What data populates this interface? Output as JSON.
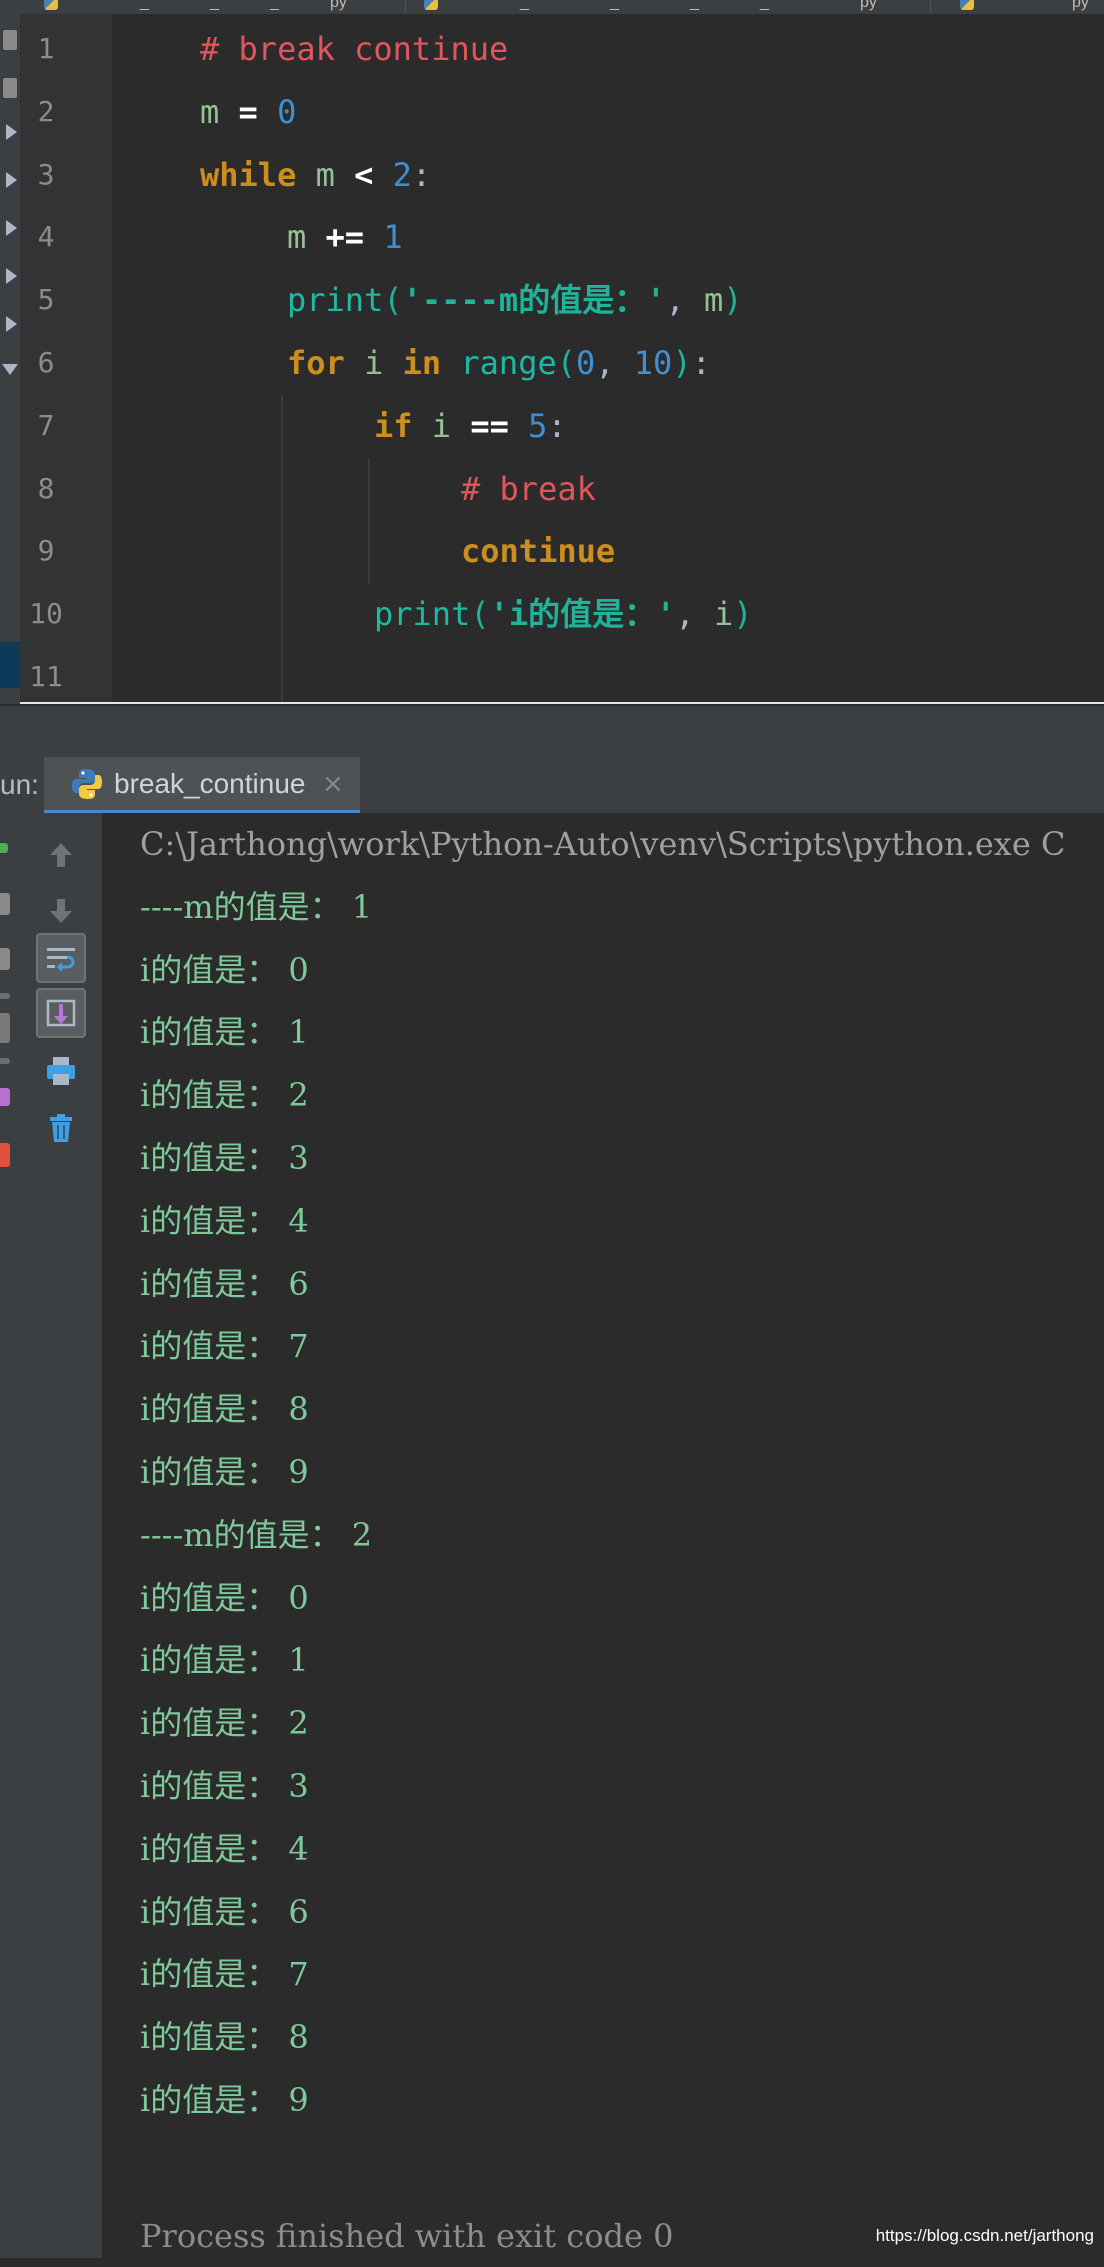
{
  "editor": {
    "tabs": [
      "_",
      "_",
      "_",
      "py",
      "_",
      "_",
      "_",
      "_",
      "py",
      "py"
    ],
    "lines": [
      {
        "num": "1",
        "indent": 0,
        "tokens": [
          {
            "t": "# break continue",
            "k": "comment"
          }
        ]
      },
      {
        "num": "2",
        "indent": 0,
        "tokens": [
          {
            "t": "m",
            "k": "var"
          },
          {
            "t": " ",
            "k": "punc"
          },
          {
            "t": "=",
            "k": "op"
          },
          {
            "t": " ",
            "k": "punc"
          },
          {
            "t": "0",
            "k": "num"
          }
        ]
      },
      {
        "num": "3",
        "indent": 0,
        "tokens": [
          {
            "t": "while",
            "k": "kw"
          },
          {
            "t": " ",
            "k": "punc"
          },
          {
            "t": "m",
            "k": "var"
          },
          {
            "t": " ",
            "k": "punc"
          },
          {
            "t": "<",
            "k": "op"
          },
          {
            "t": " ",
            "k": "punc"
          },
          {
            "t": "2",
            "k": "num"
          },
          {
            "t": ":",
            "k": "punc"
          }
        ]
      },
      {
        "num": "4",
        "indent": 1,
        "tokens": [
          {
            "t": "m",
            "k": "var"
          },
          {
            "t": " ",
            "k": "punc"
          },
          {
            "t": "+=",
            "k": "op"
          },
          {
            "t": " ",
            "k": "punc"
          },
          {
            "t": "1",
            "k": "num"
          }
        ]
      },
      {
        "num": "5",
        "indent": 1,
        "tokens": [
          {
            "t": "print",
            "k": "fn"
          },
          {
            "t": "(",
            "k": "strpunc"
          },
          {
            "t": "'----m的值是：'",
            "k": "str"
          },
          {
            "t": ", ",
            "k": "punc"
          },
          {
            "t": "m",
            "k": "var"
          },
          {
            "t": ")",
            "k": "strpunc"
          }
        ]
      },
      {
        "num": "6",
        "indent": 1,
        "tokens": [
          {
            "t": "for",
            "k": "kw"
          },
          {
            "t": " ",
            "k": "punc"
          },
          {
            "t": "i",
            "k": "var"
          },
          {
            "t": " ",
            "k": "punc"
          },
          {
            "t": "in",
            "k": "kw"
          },
          {
            "t": " ",
            "k": "punc"
          },
          {
            "t": "range",
            "k": "fn"
          },
          {
            "t": "(",
            "k": "strpunc"
          },
          {
            "t": "0",
            "k": "num"
          },
          {
            "t": ", ",
            "k": "punc"
          },
          {
            "t": "10",
            "k": "num"
          },
          {
            "t": ")",
            "k": "strpunc"
          },
          {
            "t": ":",
            "k": "punc"
          }
        ]
      },
      {
        "num": "7",
        "indent": 2,
        "tokens": [
          {
            "t": "if",
            "k": "kw"
          },
          {
            "t": " ",
            "k": "punc"
          },
          {
            "t": "i",
            "k": "var"
          },
          {
            "t": " ",
            "k": "punc"
          },
          {
            "t": "==",
            "k": "op"
          },
          {
            "t": " ",
            "k": "punc"
          },
          {
            "t": "5",
            "k": "num"
          },
          {
            "t": ":",
            "k": "punc"
          }
        ]
      },
      {
        "num": "8",
        "indent": 3,
        "tokens": [
          {
            "t": "# break",
            "k": "comment"
          }
        ]
      },
      {
        "num": "9",
        "indent": 3,
        "tokens": [
          {
            "t": "continue",
            "k": "kw"
          }
        ]
      },
      {
        "num": "10",
        "indent": 2,
        "tokens": [
          {
            "t": "print",
            "k": "fn"
          },
          {
            "t": "(",
            "k": "strpunc"
          },
          {
            "t": "'i的值是：'",
            "k": "str"
          },
          {
            "t": ", ",
            "k": "punc"
          },
          {
            "t": "i",
            "k": "var"
          },
          {
            "t": ")",
            "k": "strpunc"
          }
        ]
      },
      {
        "num": "11",
        "indent": 0,
        "tokens": []
      }
    ]
  },
  "run_panel": {
    "label": "un:",
    "tab_label": "break_continue",
    "tab_close": "×",
    "toolbar": [
      "up-arrow-icon",
      "down-arrow-icon",
      "soft-wrap-icon",
      "scroll-to-end-icon",
      "print-icon",
      "trash-icon"
    ],
    "command": "C:\\Jarthong\\work\\Python-Auto\\venv\\Scripts\\python.exe C",
    "output": [
      "----m的值是： 1",
      "i的值是： 0",
      "i的值是： 1",
      "i的值是： 2",
      "i的值是： 3",
      "i的值是： 4",
      "i的值是： 6",
      "i的值是： 7",
      "i的值是： 8",
      "i的值是： 9",
      "----m的值是： 2",
      "i的值是： 0",
      "i的值是： 1",
      "i的值是： 2",
      "i的值是： 3",
      "i的值是： 4",
      "i的值是： 6",
      "i的值是： 7",
      "i的值是： 8",
      "i的值是： 9"
    ],
    "finished": "Process finished with exit code 0"
  },
  "watermark": "https://blog.csdn.net/jarthong"
}
